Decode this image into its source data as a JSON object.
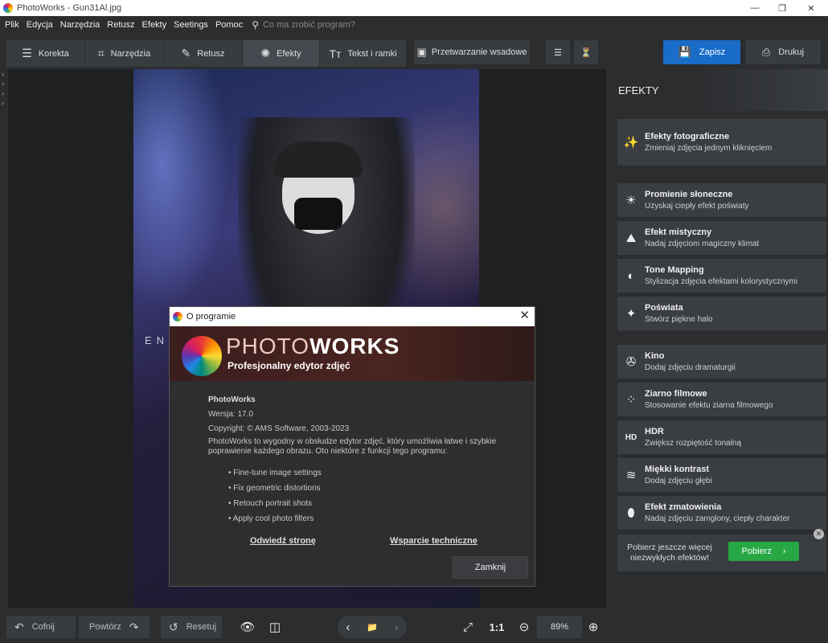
{
  "window": {
    "title": "PhotoWorks - Gun31Al.jpg",
    "controls": [
      "—",
      "❐",
      "✕"
    ]
  },
  "menu": {
    "items": [
      "Plik",
      "Edycja",
      "Narzędzia",
      "Retusz",
      "Efekty",
      "Seetings",
      "Pomoc"
    ],
    "search_placeholder": "Co ma zrobić program?"
  },
  "tabs": [
    {
      "label": "Korekta",
      "icon": "sliders-icon",
      "glyph": "☰"
    },
    {
      "label": "Narzędzia",
      "icon": "crop-icon",
      "glyph": "⌗"
    },
    {
      "label": "Retusz",
      "icon": "brush-icon",
      "glyph": "✎"
    },
    {
      "label": "Efekty",
      "icon": "sparkle-icon",
      "glyph": "✺"
    },
    {
      "label": "Tekst i ramki",
      "icon": "text-icon",
      "glyph": "Tт"
    },
    {
      "label": "Przetwarzanie wsadowe",
      "icon": "batch-icon",
      "glyph": "▣"
    }
  ],
  "toolbar": {
    "save_label": "Zapisz",
    "print_label": "Drukuj",
    "history_icon": "history-add-icon",
    "history_icon2": "history-clock-icon"
  },
  "right_panel": {
    "title": "EFEKTY",
    "featured": {
      "name": "Efekty fotograficzne",
      "desc": "Zmieniaj zdjęcia jednym kliknięciem",
      "glyph": "✨"
    },
    "effects": [
      {
        "name": "Promienie słoneczne",
        "desc": "Uzyskaj ciepły efekt poświaty",
        "glyph": "☀"
      },
      {
        "name": "Efekt mistyczny",
        "desc": "Nadaj zdjęciom magiczny klimat",
        "glyph": "⛰"
      },
      {
        "name": "Tone Mapping",
        "desc": "Stylizacja zdjęcia efektami kolorystycznymi",
        "glyph": "◐"
      },
      {
        "name": "Poświata",
        "desc": "Stwórz piękne halo",
        "glyph": "✦"
      },
      {
        "name": "Kino",
        "desc": "Dodaj zdjęciu dramaturgii",
        "glyph": "✇"
      },
      {
        "name": "Ziarno filmowe",
        "desc": "Stosowanie efektu ziarna filmowego",
        "glyph": "⁘"
      },
      {
        "name": "HDR",
        "desc": "Zwiększ rozpiętość tonalną",
        "glyph": "HD"
      },
      {
        "name": "Miękki kontrast",
        "desc": "Dodaj zdjęciu głębi",
        "glyph": "≋"
      },
      {
        "name": "Efekt zmatowienia",
        "desc": "Nadaj zdjęciu zamglony, ciepły charakter",
        "glyph": "⬮"
      }
    ],
    "promo": {
      "text": "Pobierz jeszcze więcej niezwykłych efektów!",
      "button": "Pobierz",
      "close": "✕"
    }
  },
  "bottom": {
    "undo": "Cofnij",
    "redo": "Powtórz",
    "reset": "Resetuj",
    "ratio": "1:1",
    "zoom": "89%"
  },
  "dialog": {
    "title": "O programie",
    "brand_photo": "PHOTO",
    "brand_works": "WORKS",
    "tagline": "Profesjonalny edytor zdjęć",
    "product": "PhotoWorks",
    "version": "Wersja: 17.0",
    "copyright": "Copyright: © AMS Software, 2003-2023",
    "description": "PhotoWorks to wygodny w obsłudze edytor zdjęć, który umożliwia łatwe i szybkie poprawienie każdego obrazu. Oto niektóre z funkcji tego programu:",
    "features": [
      "• Fine-tune image settings",
      "• Fix geometric distortions",
      "• Retouch portrait shots",
      "• Apply cool photo filters"
    ],
    "link_visit": "Odwiedź stronę",
    "link_support": "Wsparcie techniczne",
    "close_button": "Zamknij"
  },
  "photo_text": "ENV"
}
